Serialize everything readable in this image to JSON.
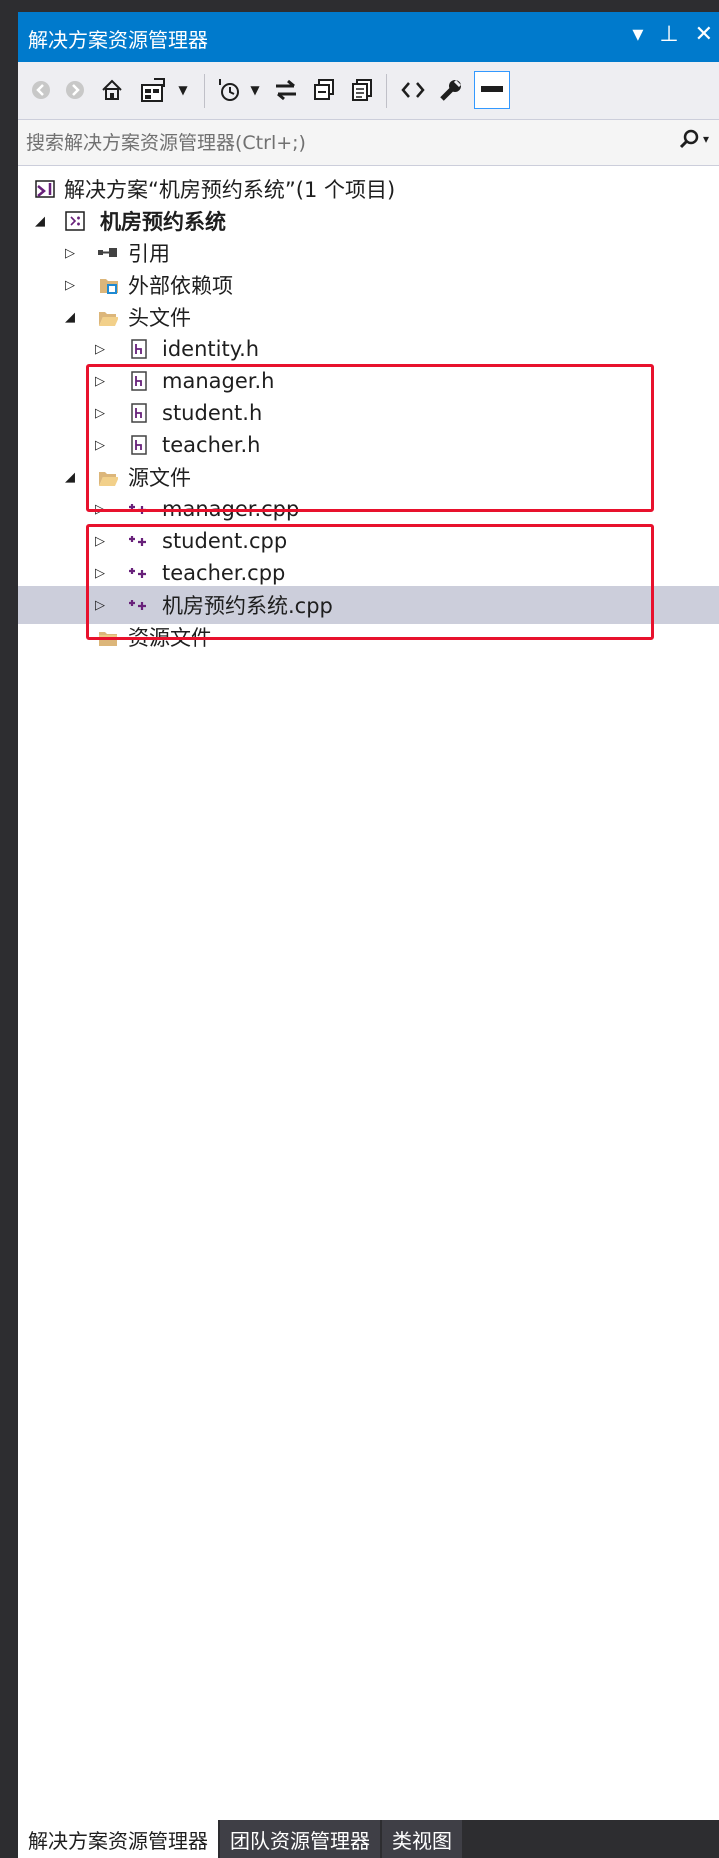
{
  "panel": {
    "title": "解决方案资源管理器",
    "controls": {
      "dropdown": "▾",
      "pin": "⊥",
      "close": "✕"
    }
  },
  "toolbar": {
    "icons": [
      "back-icon",
      "forward-icon",
      "home-icon",
      "switch-views-icon",
      "dropdown-arrow-icon",
      "pending-changes-icon",
      "dropdown-arrow-icon",
      "sync-icon",
      "collapse-all-icon",
      "show-all-files-icon",
      "view-code-icon",
      "properties-icon",
      "preview-selected-icon"
    ]
  },
  "search": {
    "placeholder": "搜索解决方案资源管理器(Ctrl+;)",
    "value": ""
  },
  "tree": {
    "solution": "解决方案“机房预约系统”(1 个项目)",
    "project": "机房预约系统",
    "references": "引用",
    "external_dependencies": "外部依赖项",
    "header_folder": "头文件",
    "header_files": [
      "identity.h",
      "manager.h",
      "student.h",
      "teacher.h"
    ],
    "source_folder": "源文件",
    "source_files": [
      "manager.cpp",
      "student.cpp",
      "teacher.cpp"
    ],
    "selected_file": "机房预约系统.cpp",
    "resource_folder": "资源文件"
  },
  "tabs": [
    {
      "label": "解决方案资源管理器",
      "active": true
    },
    {
      "label": "团队资源管理器",
      "active": false
    },
    {
      "label": "类视图",
      "active": false
    }
  ],
  "colors": {
    "title_bar": "#007acc",
    "selection": "#cccedb",
    "highlight_box": "#e8112d",
    "frame": "#2d2d30"
  }
}
